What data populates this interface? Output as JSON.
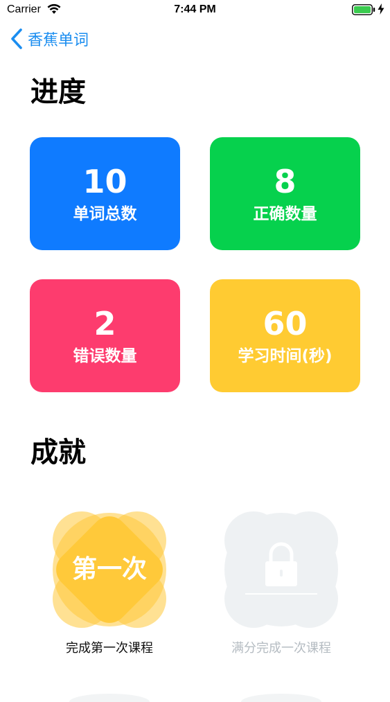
{
  "status_bar": {
    "carrier": "Carrier",
    "time": "7:44 PM"
  },
  "nav": {
    "back_label": "香蕉单词"
  },
  "progress": {
    "title": "进度",
    "stats": [
      {
        "value": "10",
        "label": "单词总数",
        "color": "#0f7bff"
      },
      {
        "value": "8",
        "label": "正确数量",
        "color": "#06d14d"
      },
      {
        "value": "2",
        "label": "错误数量",
        "color": "#fd3c6e"
      },
      {
        "value": "60",
        "label": "学习时间(秒)",
        "color": "#ffcb32"
      }
    ]
  },
  "achievements": {
    "title": "成就",
    "items": [
      {
        "badge_text": "第一次",
        "caption": "完成第一次课程",
        "unlocked": true,
        "color": "#ffc93a"
      },
      {
        "badge_text": "",
        "caption": "满分完成一次课程",
        "unlocked": false,
        "color": "#eef1f3"
      }
    ]
  }
}
